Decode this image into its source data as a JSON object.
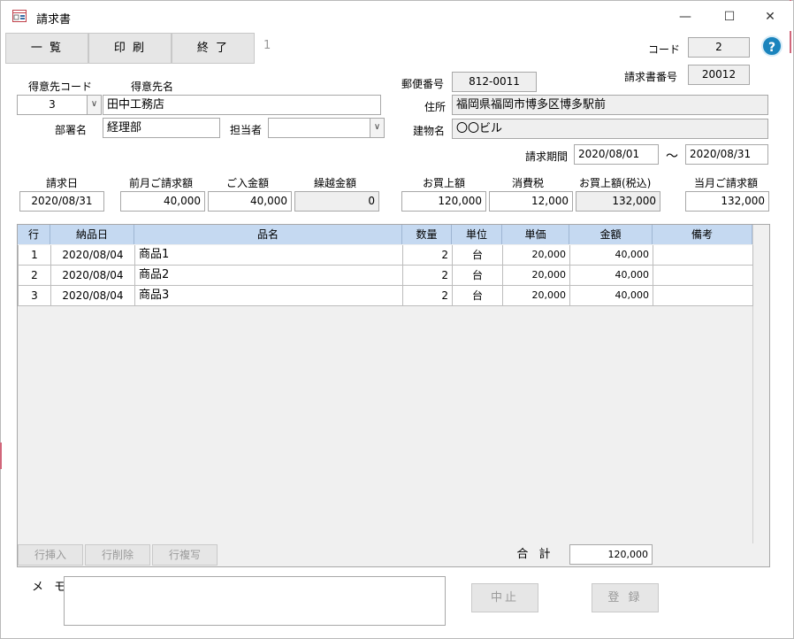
{
  "window": {
    "title": "請求書",
    "minimize": "—",
    "maximize": "☐",
    "close": "✕"
  },
  "toolbar": {
    "list": "一 覧",
    "print": "印 刷",
    "exit": "終 了",
    "record_no": "1"
  },
  "header": {
    "code_label": "コード",
    "code": "2",
    "invoice_no_label": "請求書番号",
    "invoice_no": "20012",
    "help": "?"
  },
  "customer": {
    "code_label": "得意先コード",
    "code": "3",
    "name_label": "得意先名",
    "name": "田中工務店",
    "dept_label": "部署名",
    "dept": "経理部",
    "person_label": "担当者",
    "person": ""
  },
  "address": {
    "zip_label": "郵便番号",
    "zip": "812-0011",
    "addr_label": "住所",
    "addr": "福岡県福岡市博多区博多駅前",
    "bldg_label": "建物名",
    "bldg": "〇〇ビル"
  },
  "period": {
    "label": "請求期間",
    "from": "2020/08/01",
    "sep": "～",
    "to": "2020/08/31"
  },
  "summary": {
    "date_label": "請求日",
    "date": "2020/08/31",
    "prev_label": "前月ご請求額",
    "prev": "40,000",
    "paid_label": "ご入金額",
    "paid": "40,000",
    "carry_label": "繰越金額",
    "carry": "0",
    "sales_label": "お買上額",
    "sales": "120,000",
    "tax_label": "消費税",
    "tax": "12,000",
    "sales_tax_label": "お買上額(税込)",
    "sales_tax": "132,000",
    "current_label": "当月ご請求額",
    "current": "132,000"
  },
  "grid": {
    "columns": [
      "行",
      "納品日",
      "品名",
      "数量",
      "単位",
      "単価",
      "金額",
      "備考"
    ],
    "rows": [
      {
        "line": "1",
        "date": "2020/08/04",
        "item": "商品1",
        "qty": "2",
        "unit": "台",
        "price": "20,000",
        "amount": "40,000",
        "note": ""
      },
      {
        "line": "2",
        "date": "2020/08/04",
        "item": "商品2",
        "qty": "2",
        "unit": "台",
        "price": "20,000",
        "amount": "40,000",
        "note": ""
      },
      {
        "line": "3",
        "date": "2020/08/04",
        "item": "商品3",
        "qty": "2",
        "unit": "台",
        "price": "20,000",
        "amount": "40,000",
        "note": ""
      }
    ],
    "insert_row": "行挿入",
    "delete_row": "行削除",
    "copy_row": "行複写",
    "total_label": "合 計",
    "total": "120,000"
  },
  "memo": {
    "label": "メ モ",
    "value": ""
  },
  "actions": {
    "cancel": "中止",
    "register": "登 録"
  }
}
